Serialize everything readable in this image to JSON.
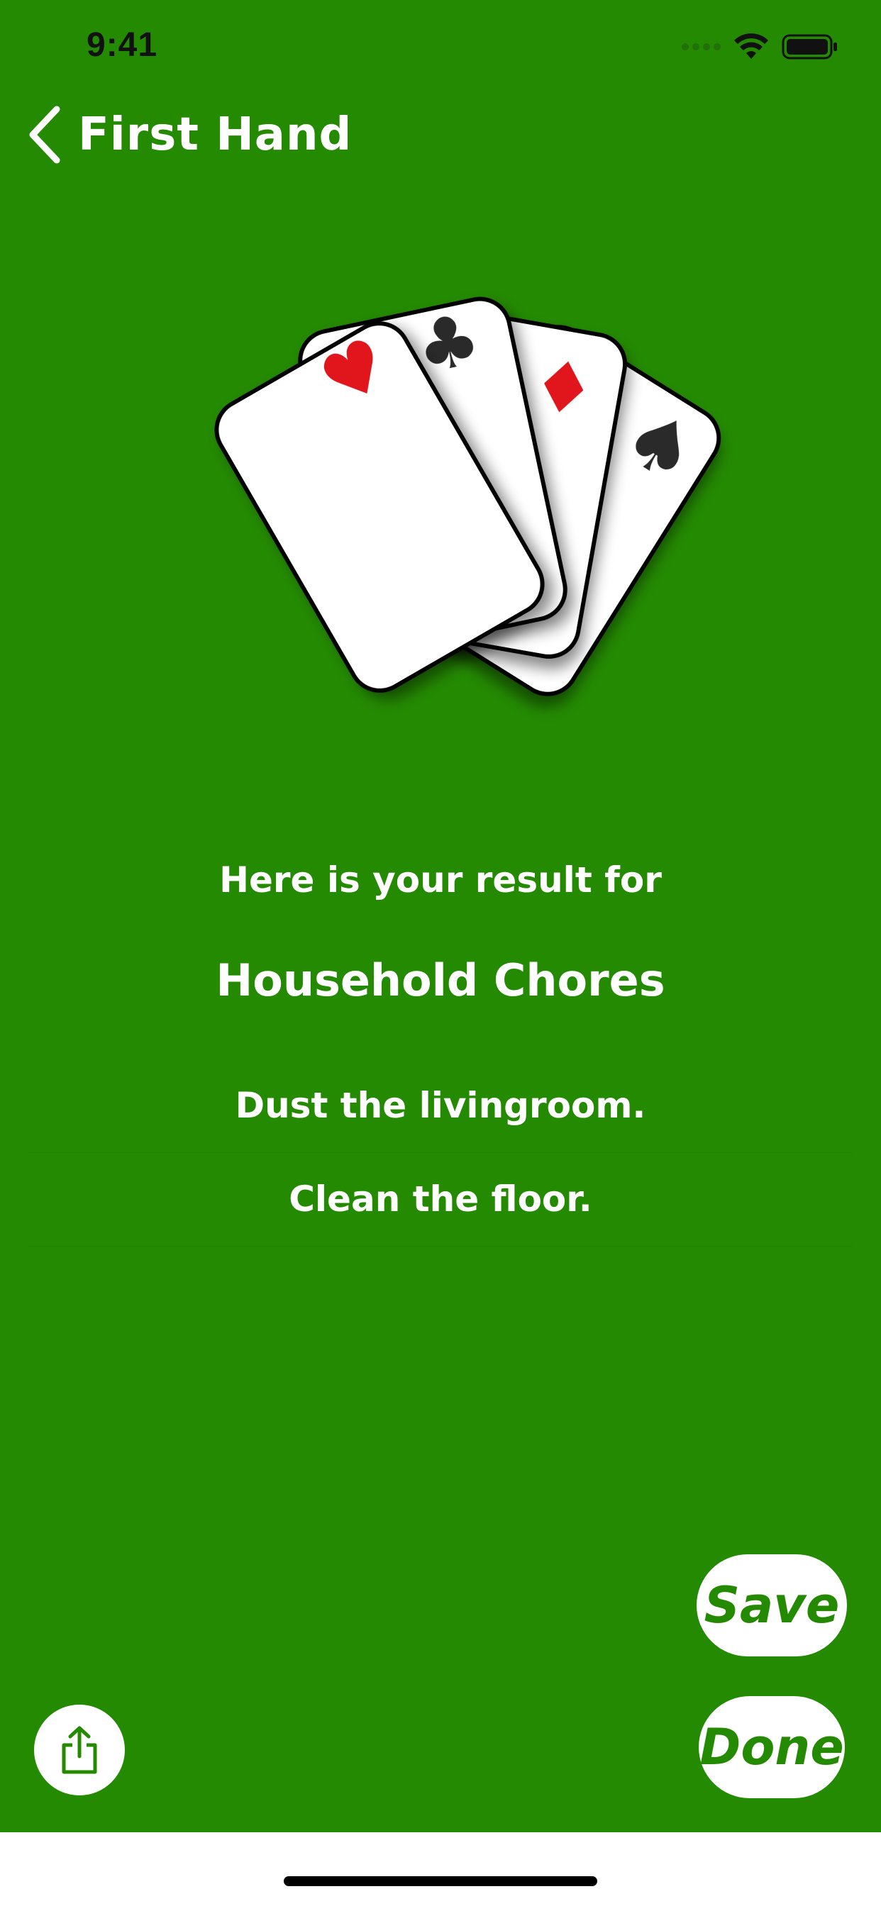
{
  "status_bar": {
    "time": "9:41"
  },
  "nav": {
    "back_icon": "chevron-left-icon",
    "title": "First Hand"
  },
  "cards": {
    "suits": [
      "heart",
      "club",
      "diamond",
      "spade"
    ],
    "symbols": [
      "♥",
      "♣",
      "♦",
      "♠"
    ]
  },
  "result": {
    "intro": "Here is your result for",
    "category": "Household Chores",
    "items": [
      "Dust the livingroom.",
      "Clean the floor."
    ]
  },
  "buttons": {
    "save_label": "Save",
    "done_label": "Done",
    "share_icon": "share-icon"
  },
  "colors": {
    "background": "#248a02",
    "button_bg": "#ffffff",
    "button_text": "#248a02",
    "heart": "#e0141c",
    "diamond": "#e0141c",
    "club": "#2a2a2a",
    "spade": "#2a2a2a"
  }
}
